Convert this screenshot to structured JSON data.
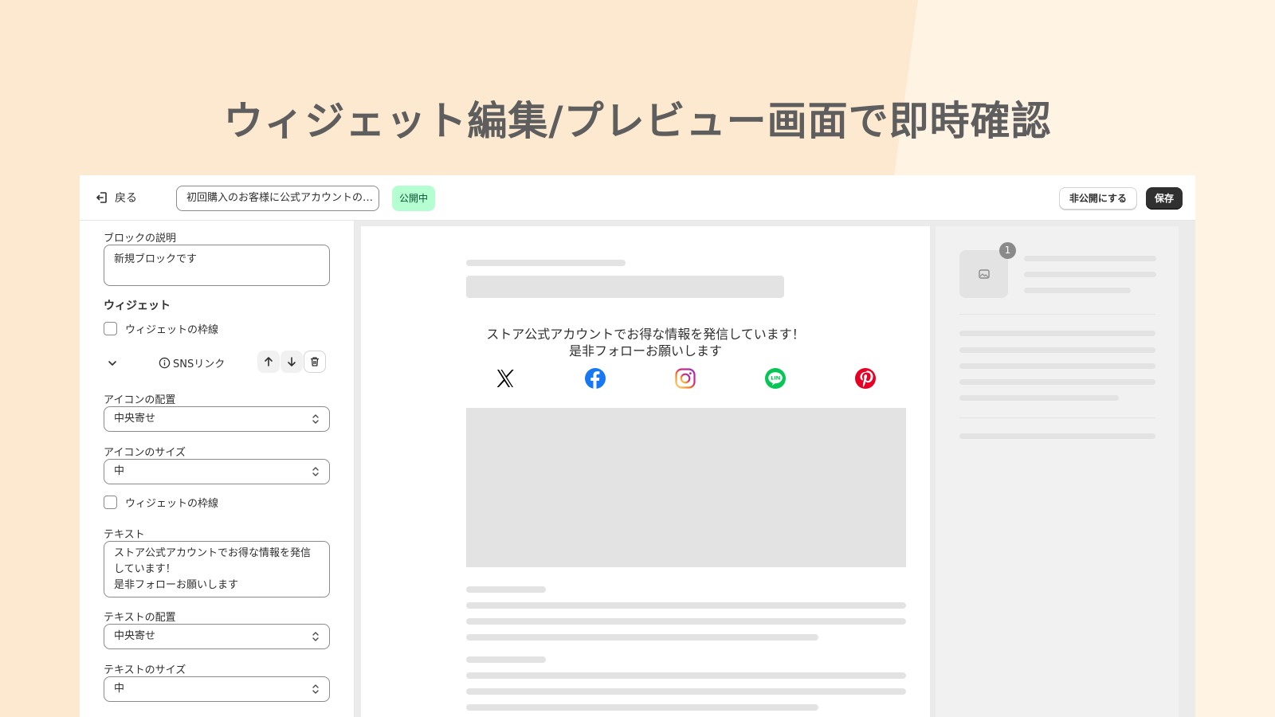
{
  "headline": "ウィジェット編集/プレビュー画面で即時確認",
  "topbar": {
    "back_label": "戻る",
    "title_value": "初回購入のお客様に公式アカウントの…",
    "status_badge": "公開中",
    "unpublish_label": "非公開にする",
    "save_label": "保存"
  },
  "sidebar": {
    "block_description_label": "ブロックの説明",
    "block_description_value": "新規ブロックです",
    "widget_section_title": "ウィジェット",
    "widget_border_label_1": "ウィジェットの枠線",
    "widget_item_label": "SNSリンク",
    "icon_alignment_label": "アイコンの配置",
    "icon_alignment_value": "中央寄せ",
    "icon_size_label": "アイコンのサイズ",
    "icon_size_value": "中",
    "widget_border_label_2": "ウィジェットの枠線",
    "text_label": "テキスト",
    "text_value_lines": [
      "ストア公式アカウントでお得な情報を発信",
      "しています！",
      "是非フォローお願いします"
    ],
    "text_alignment_label": "テキストの配置",
    "text_alignment_value": "中央寄せ",
    "text_size_label": "テキストのサイズ",
    "text_size_value": "中"
  },
  "preview": {
    "sns_text_line1": "ストア公式アカウントでお得な情報を発信しています！",
    "sns_text_line2": "是非フォローお願いします",
    "social_icons": [
      "x-icon",
      "facebook-icon",
      "instagram-icon",
      "line-icon",
      "pinterest-icon"
    ],
    "thumbnail_count": "1"
  },
  "colors": {
    "background": "#fde9cf",
    "status_badge": "#b4fed2",
    "save_button": "#303030",
    "facebook": "#1877f2",
    "line": "#06c755",
    "pinterest": "#e60023"
  }
}
